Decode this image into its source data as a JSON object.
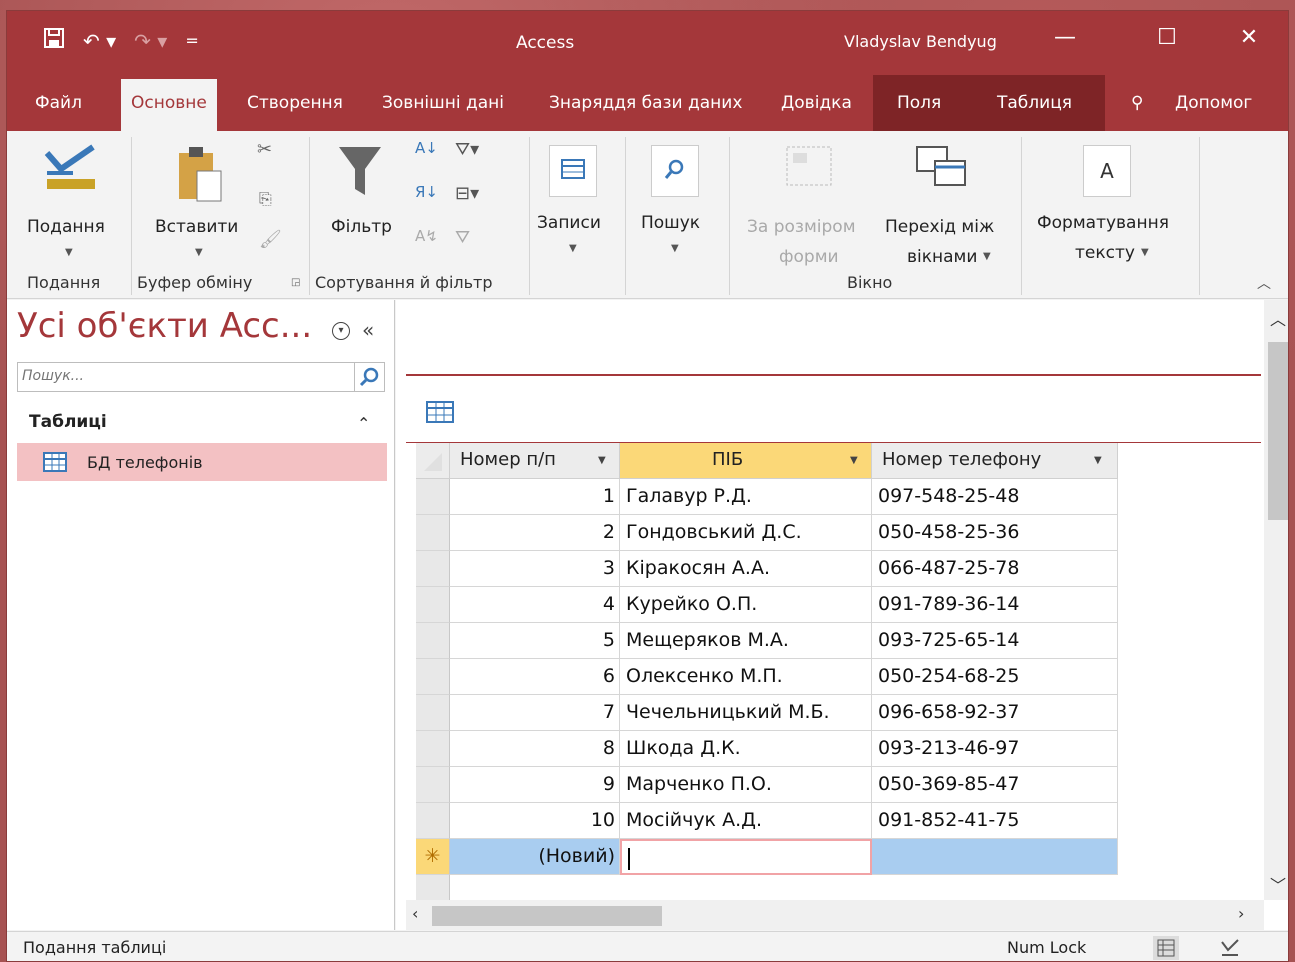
{
  "window": {
    "app_title": "Access",
    "user_name": "Vladyslav Bendyug",
    "minimize": "—",
    "maximize": "☐",
    "close": "✕"
  },
  "qat": {
    "save": "🖫",
    "undo": "↶ ▾",
    "redo": "↷ ▾",
    "customize": "="
  },
  "tabs": [
    "Файл",
    "Основне",
    "Створення",
    "Зовнішні дані",
    "Знаряддя бази даних",
    "Довідка",
    "Поля",
    "Таблиця"
  ],
  "active_tab": "Основне",
  "tell_me": "Допомог",
  "ribbon": {
    "view_label": "Подання",
    "paste_label": "Вставити",
    "filter_label": "Фільтр",
    "records_label": "Записи",
    "find_label": "Пошук",
    "size_to_fit_line1": "За розміром",
    "size_to_fit_line2": "форми",
    "switch_windows_line1": "Перехід між",
    "switch_windows_line2": "вікнами",
    "text_format_line1": "Форматування",
    "text_format_line2": "тексту",
    "groups": {
      "views": "Подання",
      "clipboard": "Буфер обміну",
      "sort_filter": "Сортування й фільтр",
      "window": "Вікно"
    }
  },
  "nav": {
    "title": "Усі об'єкти Acc...",
    "search_placeholder": "Пошук...",
    "group": "Таблиці",
    "items": [
      {
        "label": "БД телефонів"
      }
    ]
  },
  "table": {
    "columns": [
      "Номер п/п",
      "ПІБ",
      "Номер телефону"
    ],
    "rows": [
      {
        "id": "1",
        "name": "Галавур Р.Д.",
        "phone": "097-548-25-48"
      },
      {
        "id": "2",
        "name": "Гондовський Д.С.",
        "phone": "050-458-25-36"
      },
      {
        "id": "3",
        "name": "Кіракосян А.А.",
        "phone": "066-487-25-78"
      },
      {
        "id": "4",
        "name": "Курейко О.П.",
        "phone": "091-789-36-14"
      },
      {
        "id": "5",
        "name": "Мещеряков М.А.",
        "phone": "093-725-65-14"
      },
      {
        "id": "6",
        "name": "Олексенко М.П.",
        "phone": "050-254-68-25"
      },
      {
        "id": "7",
        "name": "Чечельницький М.Б.",
        "phone": "096-658-92-37"
      },
      {
        "id": "8",
        "name": "Шкода Д.К.",
        "phone": "093-213-46-97"
      },
      {
        "id": "9",
        "name": "Марченко П.О.",
        "phone": "050-369-85-47"
      },
      {
        "id": "10",
        "name": "Мосійчук А.Д.",
        "phone": "091-852-41-75"
      }
    ],
    "new_row_label": "(Новий)",
    "new_row_marker": "✳"
  },
  "status": {
    "left": "Подання таблиці",
    "num_lock": "Num Lock"
  },
  "colors": {
    "accent": "#a4373a",
    "selection": "#a9cdf0",
    "header_selected": "#fbd878"
  }
}
